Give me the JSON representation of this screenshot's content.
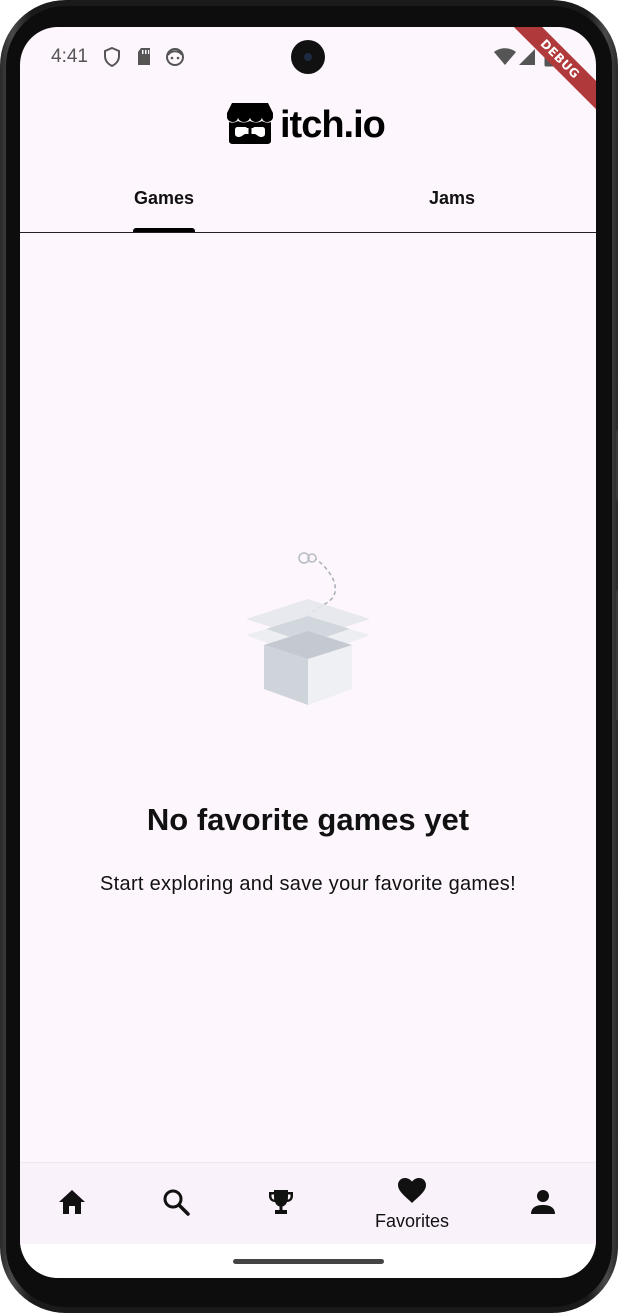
{
  "status_bar": {
    "time": "4:41"
  },
  "debug_banner": "DEBUG",
  "app_bar": {
    "logo_text": "itch.io"
  },
  "tabs": [
    {
      "label": "Games",
      "selected": true
    },
    {
      "label": "Jams",
      "selected": false
    }
  ],
  "empty_state": {
    "title": "No favorite games yet",
    "subtitle": "Start exploring and save your favorite games!",
    "illustration": "empty-box-icon"
  },
  "bottom_nav": {
    "items": [
      {
        "icon": "home-icon",
        "label": ""
      },
      {
        "icon": "search-icon",
        "label": ""
      },
      {
        "icon": "trophy-icon",
        "label": ""
      },
      {
        "icon": "heart-icon",
        "label": "Favorites",
        "selected": true
      },
      {
        "icon": "person-icon",
        "label": ""
      }
    ]
  },
  "colors": {
    "background": "#fdf6fd",
    "nav_background": "#faf2fa",
    "debug_ribbon": "#b0393b",
    "text": "#111111"
  }
}
